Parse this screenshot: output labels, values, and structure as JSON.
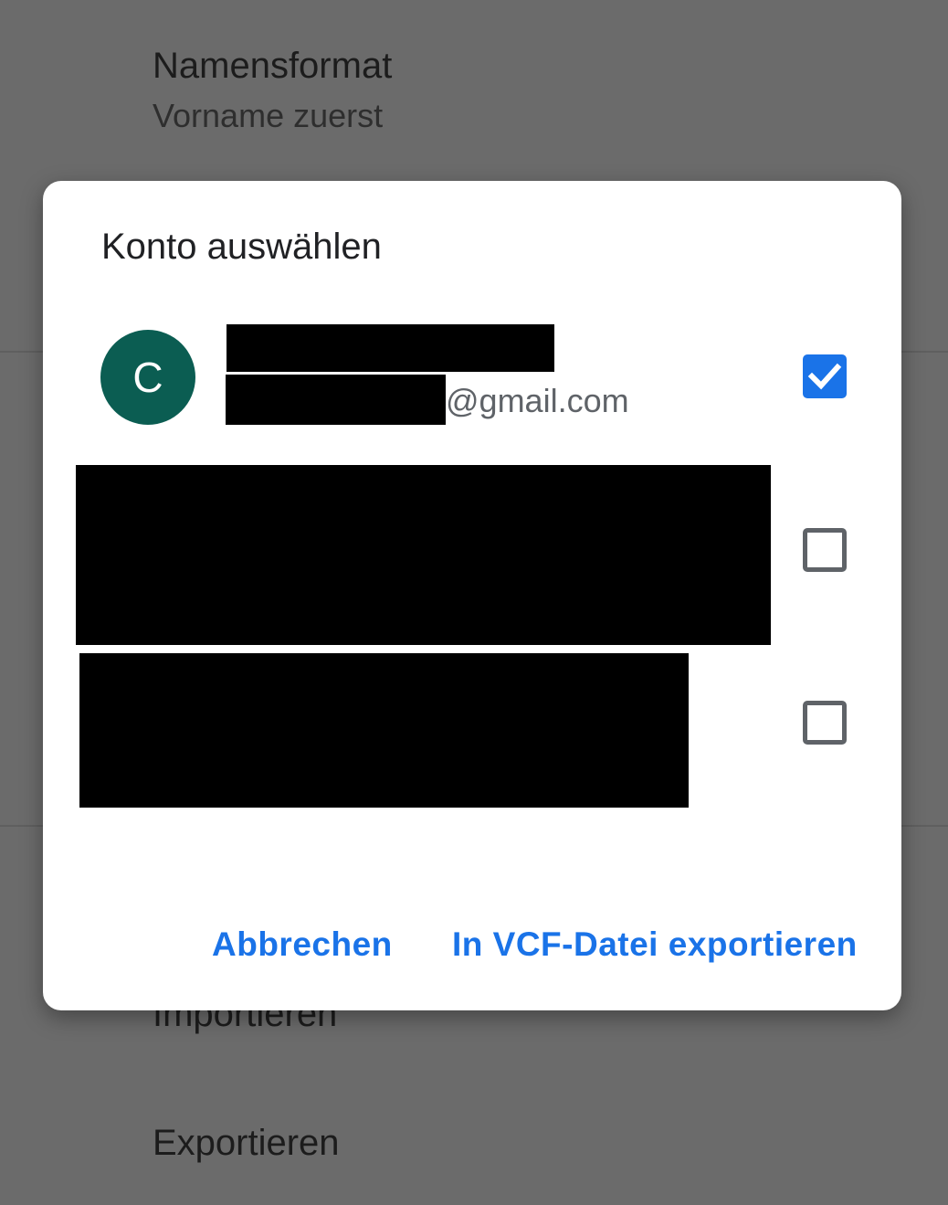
{
  "background": {
    "name_format_title": "Namensformat",
    "name_format_value": "Vorname zuerst",
    "import_label": "Importieren",
    "export_label": "Exportieren"
  },
  "dialog": {
    "title": "Konto auswählen",
    "accounts": [
      {
        "avatar_letter": "C",
        "email_suffix": "@gmail.com",
        "checked": true
      },
      {
        "checked": false
      },
      {
        "checked": false
      }
    ],
    "cancel_label": "Abbrechen",
    "export_vcf_label": "In VCF-Datei exportieren"
  },
  "colors": {
    "accent": "#1a73e8",
    "avatar": "#0b5d52",
    "scrim": "#6b6b6b"
  },
  "icons": {
    "checkbox_checked": "check-icon"
  }
}
